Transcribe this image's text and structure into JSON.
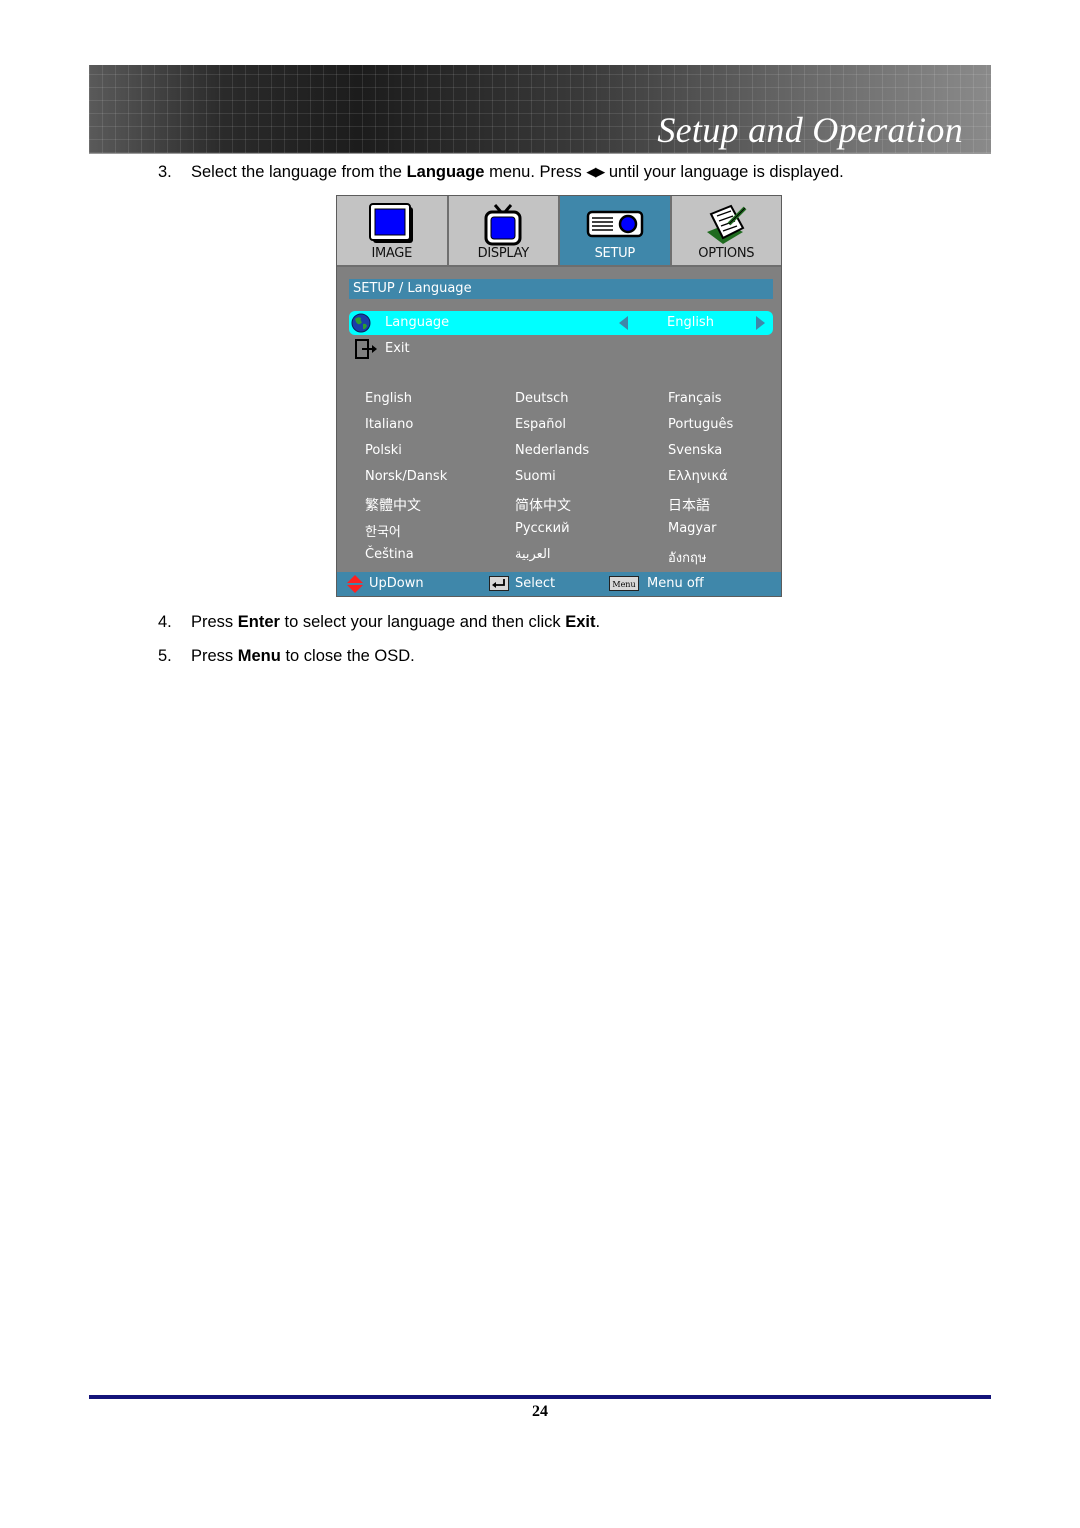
{
  "header": {
    "title": "Setup and Operation"
  },
  "steps": [
    {
      "num": "3.",
      "pre": "Select the language from the ",
      "bold": "Language",
      "mid": " menu. Press ",
      "arrows": "◀▶",
      "post": " until your language is displayed."
    },
    {
      "num": "4.",
      "pre": "Press ",
      "bold": "Enter",
      "mid": " to select your language and then click ",
      "bold2": "Exit",
      "post": "."
    },
    {
      "num": "5.",
      "pre": "Press ",
      "bold": "Menu",
      "post": " to close the OSD."
    }
  ],
  "osd": {
    "tabs": [
      {
        "label": "IMAGE",
        "icon": "monitor-icon",
        "active": false
      },
      {
        "label": "DISPLAY",
        "icon": "tv-icon",
        "active": false
      },
      {
        "label": "SETUP",
        "icon": "projector-icon",
        "active": true
      },
      {
        "label": "OPTIONS",
        "icon": "notepad-icon",
        "active": false
      }
    ],
    "breadcrumb": "SETUP / Language",
    "language_row": {
      "label": "Language",
      "value": "English",
      "icon": "globe-icon"
    },
    "exit_row": {
      "label": "Exit",
      "icon": "exit-icon"
    },
    "languages": [
      [
        "English",
        "Deutsch",
        "Français"
      ],
      [
        "Italiano",
        "Español",
        "Português"
      ],
      [
        "Polski",
        "Nederlands",
        "Svenska"
      ],
      [
        "Norsk/Dansk",
        "Suomi",
        "Ελληνικά"
      ],
      [
        "繁體中文",
        "简体中文",
        "日本語"
      ],
      [
        "한국어",
        "Русский",
        "Magyar"
      ],
      [
        "Čeština",
        "العربية",
        "อังกฤษ"
      ]
    ],
    "footer": {
      "updown": "UpDown",
      "select": "Select",
      "menu_key": "Menu",
      "menu_off": "Menu off"
    },
    "colors": {
      "accent": "#3f87aa",
      "highlight": "#00ffff",
      "panel": "#808080",
      "tab": "#c3c3c3"
    }
  },
  "page_number": "24"
}
